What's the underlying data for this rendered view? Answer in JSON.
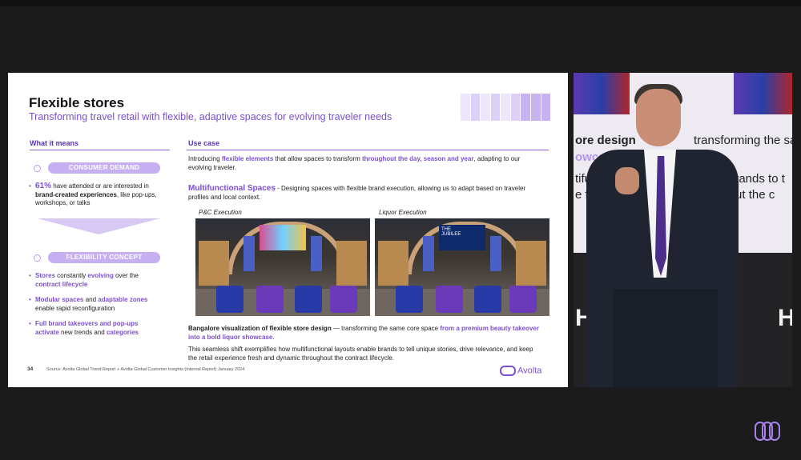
{
  "slide": {
    "title": "Flexible stores",
    "subtitle": "Transforming travel retail with flexible, adaptive spaces for evolving traveler needs",
    "left_header": "What it means",
    "right_header": "Use case",
    "pill1": "CONSUMER DEMAND",
    "demand_pct": "61%",
    "demand_t1": " have attended or are interested in ",
    "demand_bold": "brand-created experiences",
    "demand_t2": ", like pop-ups, workshops, or talks",
    "pill2": "FLEXIBILITY CONCEPT",
    "c1_a": "Stores",
    "c1_b": " constantly ",
    "c1_c": "evolving",
    "c1_d": " over the ",
    "c1_e": "contract lifecycle",
    "c2_a": "Modular spaces",
    "c2_b": " and ",
    "c2_c": "adaptable zones",
    "c2_d": " enable rapid reconfiguration",
    "c3_a": "Full brand takeovers and pop-ups activate",
    "c3_b": " new trends and ",
    "c3_c": "categories",
    "intro_a": "Introducing ",
    "intro_b": "flexible elements",
    "intro_c": " that allow spaces to transform ",
    "intro_d": "throughout the day, season and year",
    "intro_e": ", adapting to our evolving traveler.",
    "multi_title": "Multifunctional Spaces",
    "multi_text": " - Designing spaces with flexible brand execution, allowing us to adapt based on traveler profiles and local context.",
    "img1_label": "P&C Execution",
    "img2_label": "Liquor Execution",
    "img2_sign_a": "THE",
    "img2_sign_b": "JUBILEE",
    "cap1_a": "Bangalore visualization of flexible store design",
    "cap1_b": " — transforming the same core space ",
    "cap1_c": "from a premium beauty takeover into a bold liquor showcase.",
    "cap2": "This seamless shift exemplifies how multifunctional layouts enable brands to tell unique stories, drive relevance, and keep the retail experience fresh and dynamic throughout the contract lifecycle.",
    "page_num": "34",
    "source": "Source: Avolta Global Trend Report + Avolta Global Customer Insights (Internal Report) January 2024",
    "logo": "Avolta"
  },
  "video": {
    "line1": "ore design",
    "line1b": "transforming the same c",
    "line2": "owcase.",
    "line3": "tifu",
    "line3b": "brands to t",
    "line4": "e f",
    "line4b": "ghout the c",
    "sign_left": "HU",
    "sign_right": "H"
  },
  "colors": {
    "accent": "#7b4fd0",
    "pill": "#c6b0f2",
    "background": "#1b1b1b"
  }
}
